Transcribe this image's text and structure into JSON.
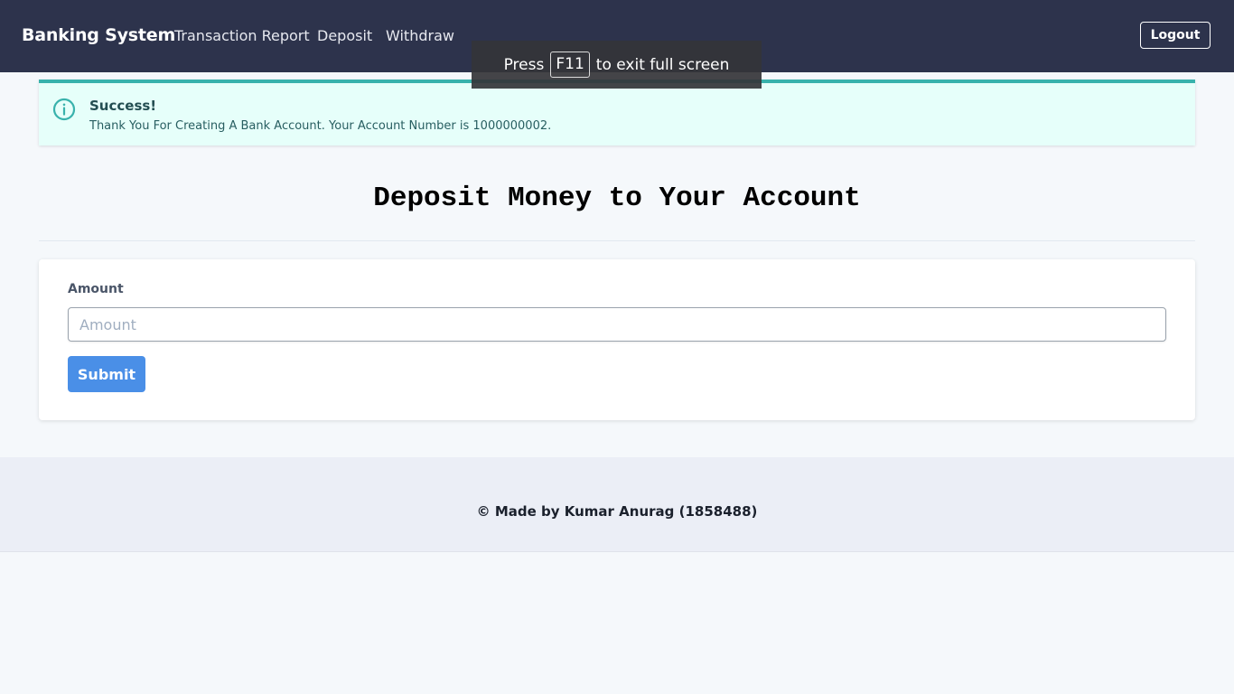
{
  "navbar": {
    "brand": "Banking System",
    "links": [
      "Transaction Report",
      "Deposit",
      "Withdraw"
    ],
    "logout_label": "Logout",
    "background": "#2d334c"
  },
  "fullscreen_toast": {
    "prefix": "Press",
    "key": "F11",
    "suffix": "to exit full screen"
  },
  "alert": {
    "icon": "info-circle-icon",
    "title": "Success!",
    "message": "Thank You For Creating A Bank Account. Your Account Number is 1000000002.",
    "accent": "#38b2ac"
  },
  "page": {
    "title": "Deposit Money to Your Account"
  },
  "form": {
    "amount_label": "Amount",
    "amount_placeholder": "Amount",
    "amount_value": "",
    "submit_label": "Submit",
    "submit_color": "#4a8fe7"
  },
  "footer": {
    "text": "© Made by Kumar Anurag (1858488)"
  }
}
